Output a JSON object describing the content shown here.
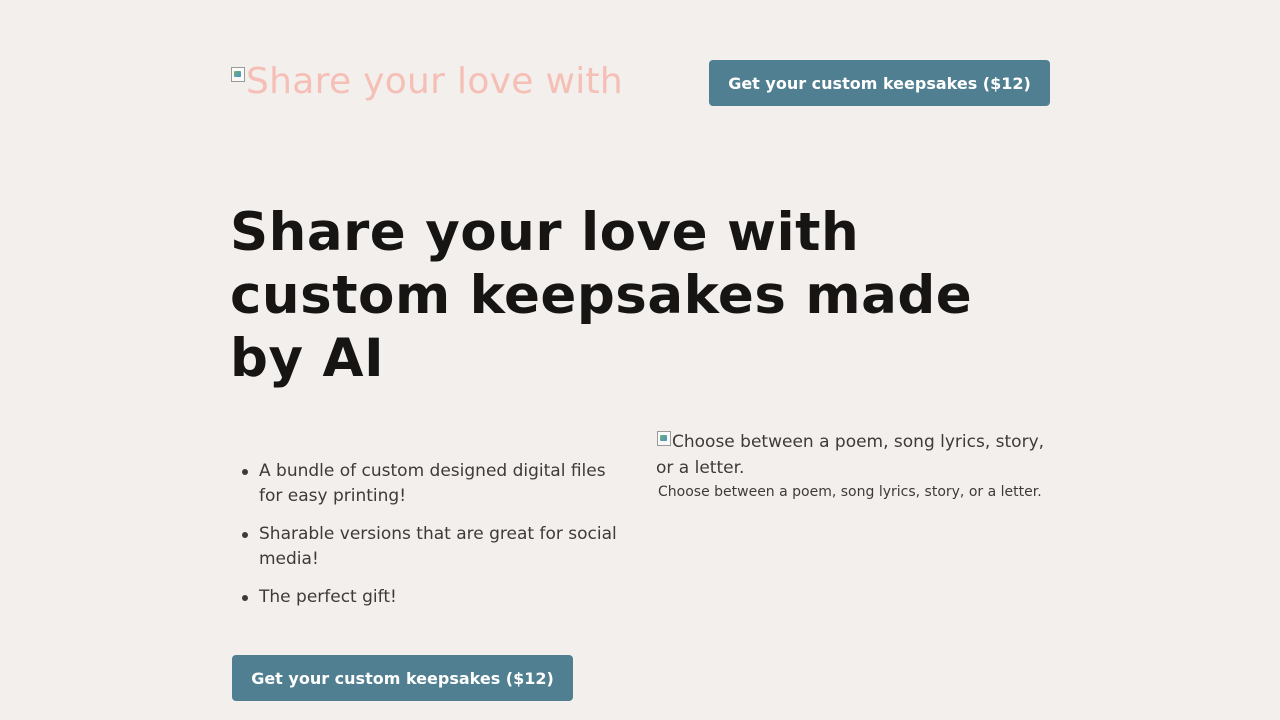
{
  "header": {
    "logo_alt": "Share your love with",
    "cta_label": "Get your custom keepsakes ($12)"
  },
  "hero": {
    "title": "Share your love with custom keepsakes made by AI"
  },
  "features": {
    "items": [
      "A bundle of custom designed digital files for easy printing!",
      "Sharable versions that are great for social media!",
      "The perfect gift!"
    ]
  },
  "figure": {
    "image_alt": "Choose between a poem, song lyrics, story, or a letter.",
    "caption": "Choose between a poem, song lyrics, story, or a letter."
  },
  "footer_cta": {
    "label": "Get your custom keepsakes ($12)"
  },
  "colors": {
    "background": "#f2efec",
    "button": "#507f91",
    "logo_alt_text": "#f6bfb6",
    "heading": "#161514",
    "body_text": "#3d3a38"
  },
  "icons": {
    "broken_image": "broken-image-icon"
  }
}
